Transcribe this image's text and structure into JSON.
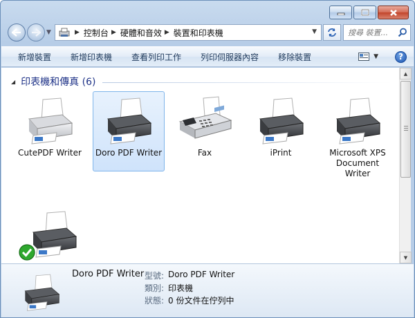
{
  "address": {
    "crumbs": [
      "控制台",
      "硬體和音效",
      "裝置和印表機"
    ],
    "search_placeholder": "搜尋 裝置..."
  },
  "commands": [
    "新增裝置",
    "新增印表機",
    "查看列印工作",
    "列印伺服器內容",
    "移除裝置"
  ],
  "group": {
    "title": "印表機和傳真 (6)"
  },
  "devices": [
    {
      "label": "CutePDF Writer",
      "icon": "printer-icon"
    },
    {
      "label": "Doro PDF Writer",
      "icon": "printer-icon",
      "selected": true
    },
    {
      "label": "Fax",
      "icon": "fax-icon"
    },
    {
      "label": "iPrint",
      "icon": "printer-icon"
    },
    {
      "label": "Microsoft XPS Document Writer",
      "icon": "printer-icon"
    },
    {
      "label": "",
      "icon": "printer-icon",
      "default": true
    }
  ],
  "details": {
    "name": "Doro PDF Writer",
    "rows": [
      {
        "key": "型號:",
        "value": "Doro PDF Writer"
      },
      {
        "key": "類別:",
        "value": "印表機"
      },
      {
        "key": "狀態:",
        "value": "0 份文件在佇列中"
      }
    ]
  },
  "help_label": "?"
}
